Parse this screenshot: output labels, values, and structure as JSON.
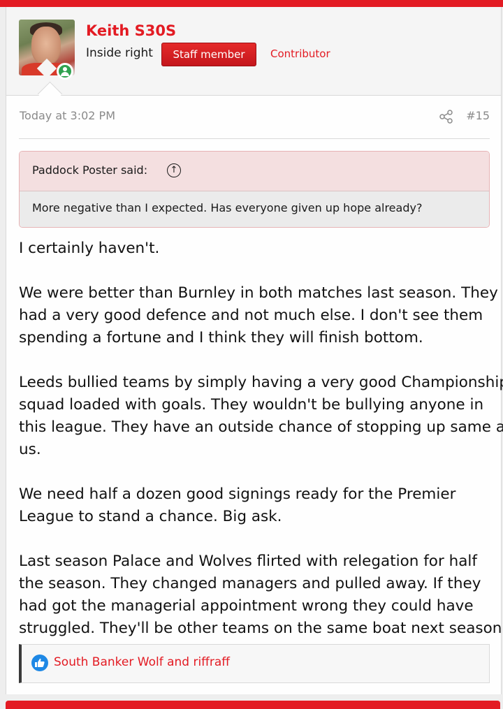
{
  "user": {
    "name": "Keith S30S",
    "title": "Inside right",
    "staff_badge": "Staff member",
    "role": "Contributor"
  },
  "meta": {
    "date": "Today at 3:02 PM",
    "post_number": "#15"
  },
  "quote": {
    "author": "Paddock Poster said:",
    "text": "More negative than I expected. Has everyone given up hope already?"
  },
  "body": {
    "p1_l1": "I certainly haven't.",
    "p2_l1": "We were better than Burnley in both matches last season. They",
    "p2_l2": "had a very good defence and not much else. I don't see them",
    "p2_l3": "spending a fortune and I think they will finish bottom.",
    "p3_l1": "Leeds bullied teams by simply having a very good Championship",
    "p3_l2": "squad loaded with goals. They wouldn't be bullying anyone in",
    "p3_l3": "this league. They have an outside chance of stopping up same as",
    "p3_l4": "us.",
    "p4_l1": "We need half a dozen good signings ready for the Premier",
    "p4_l2": "League to stand a chance. Big ask.",
    "p5_l1": "Last season Palace and Wolves flirted with relegation for half",
    "p5_l2": "the season. They changed managers and pulled away. If they",
    "p5_l3": "had got the managerial appointment wrong they could have",
    "p5_l4": "struggled. They'll be other teams on the same boat next season."
  },
  "reactions": {
    "names": "South Banker Wolf and riffraff"
  },
  "colors": {
    "brand_red": "#e31b23",
    "like_blue": "#1e88e5",
    "online_green": "#2fa14f"
  },
  "icons": {
    "share": "share-icon",
    "quote_jump": "arrow-up-circle-icon",
    "like": "thumbs-up-icon",
    "online": "user-online-icon"
  }
}
